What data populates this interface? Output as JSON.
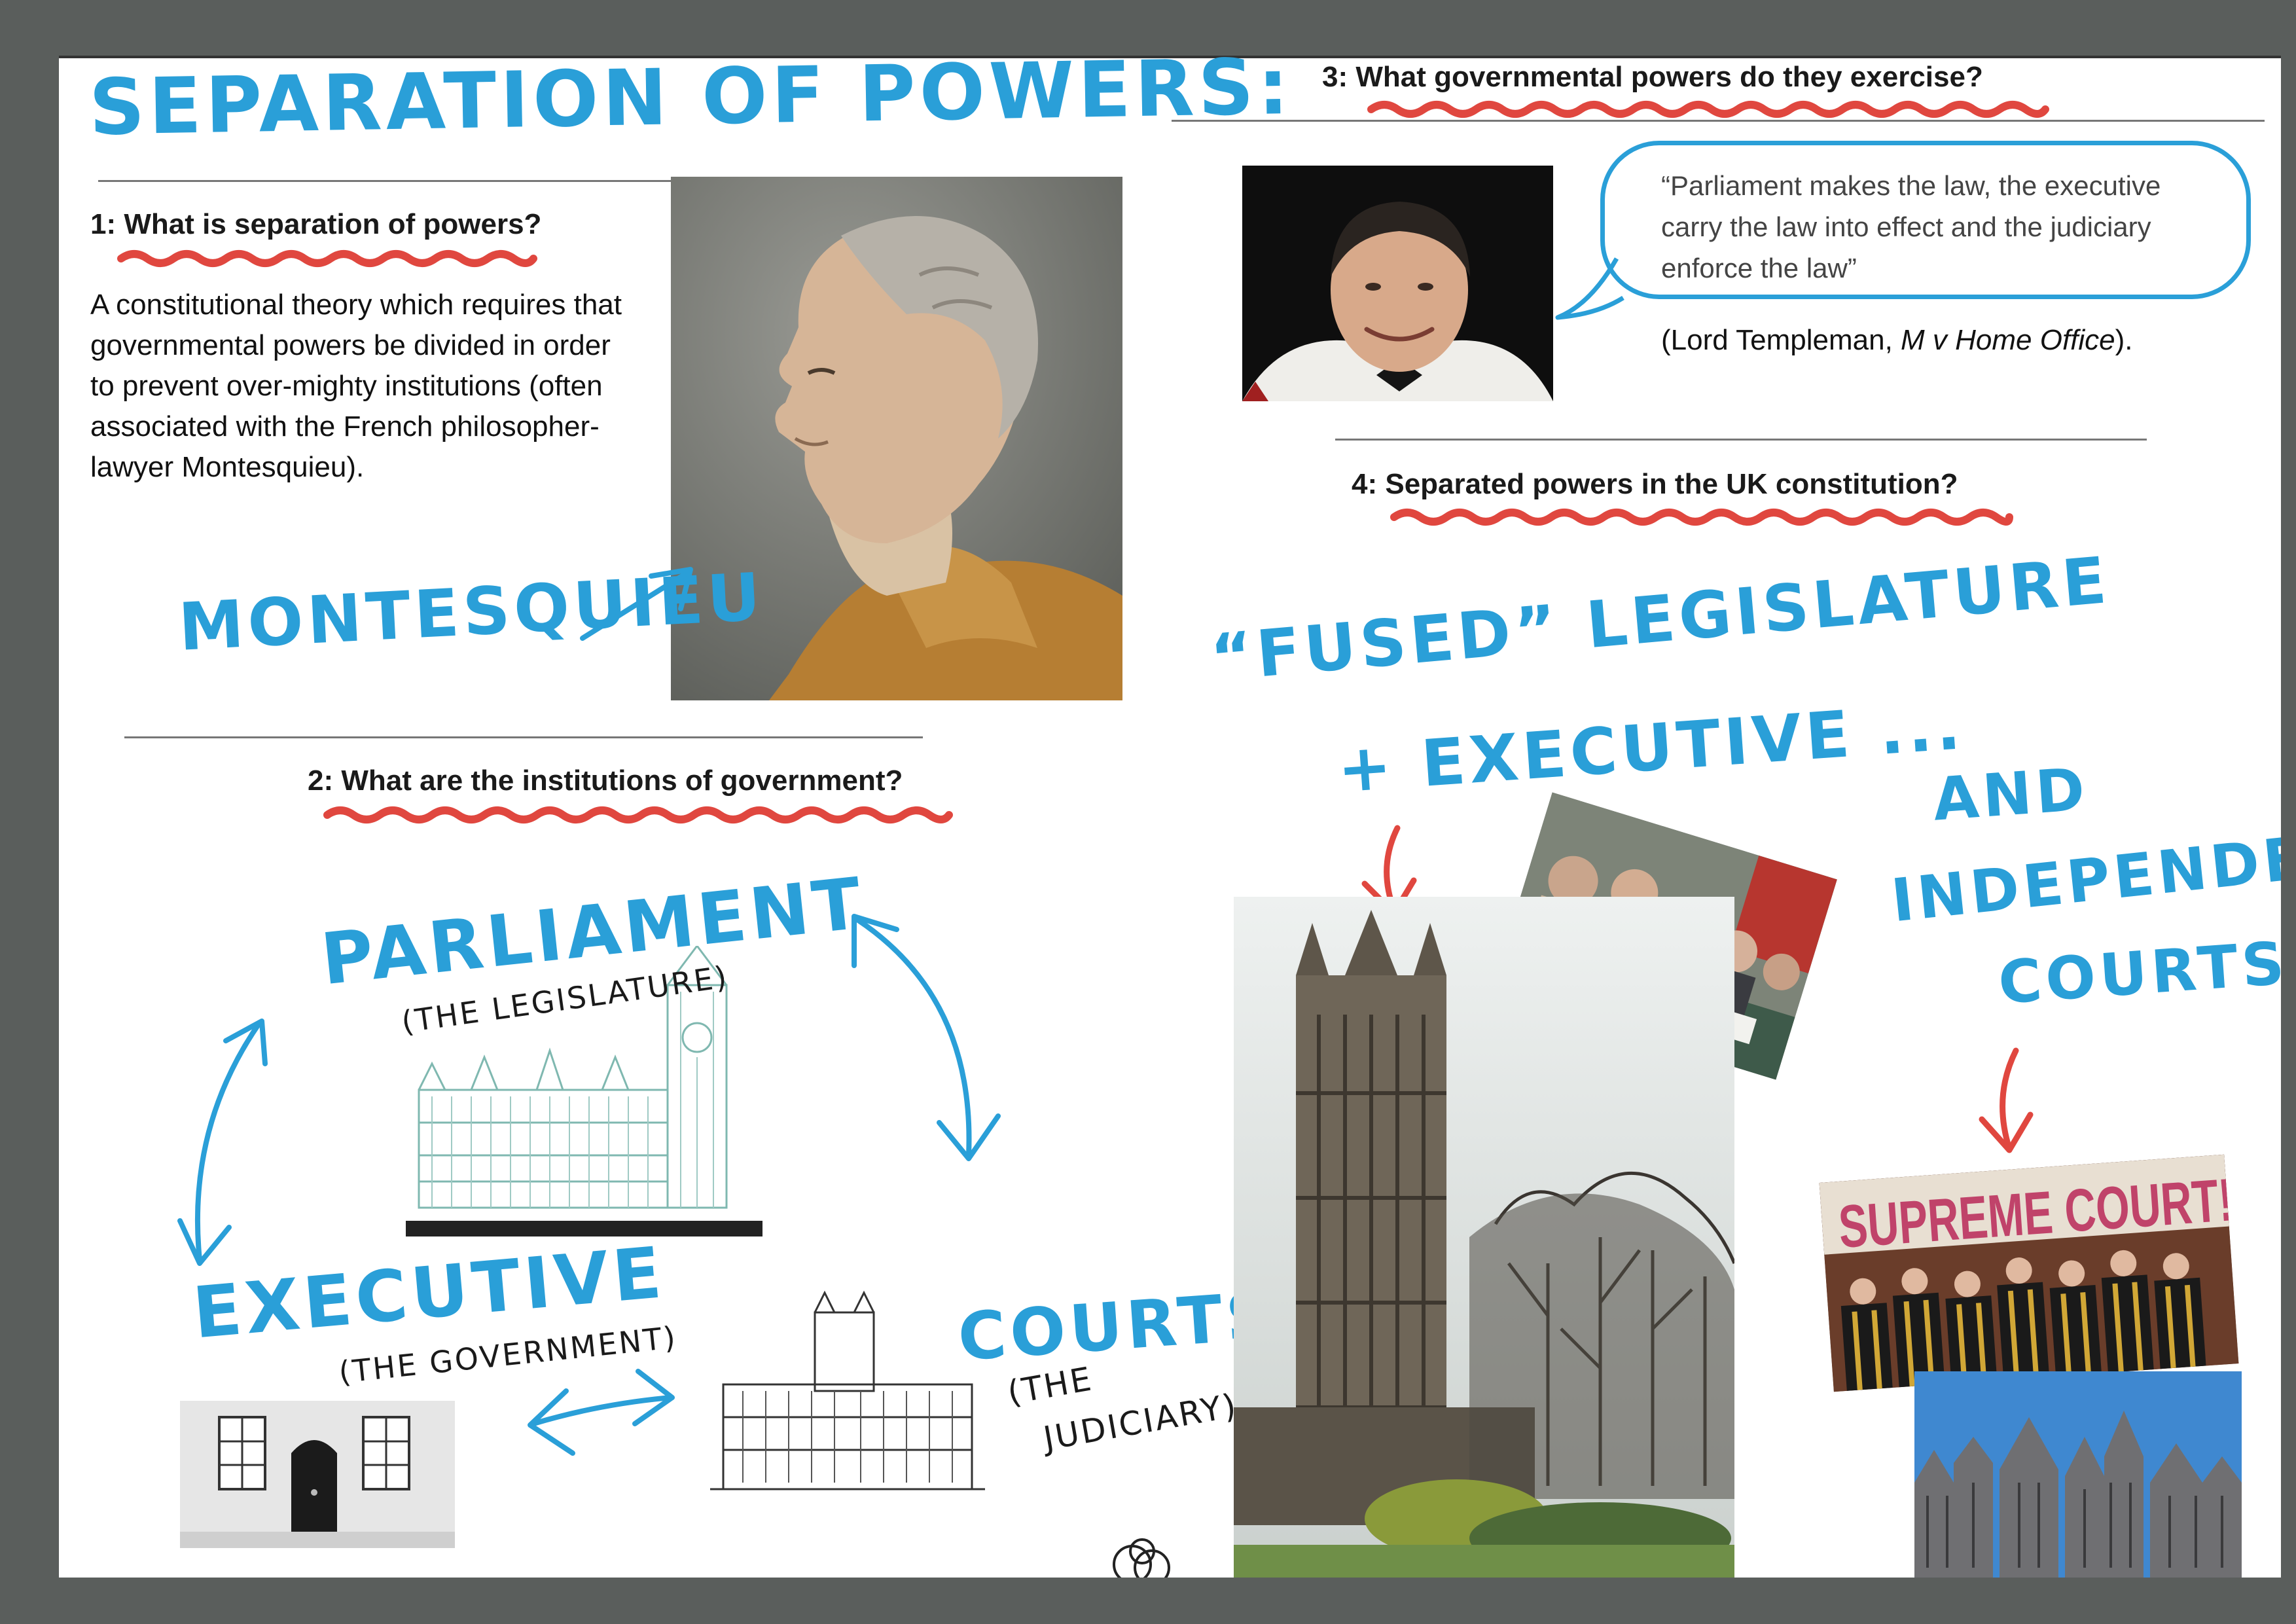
{
  "title": "SEPARATION OF POWERS:",
  "q1": {
    "heading": "1: What is separation of powers?",
    "body": "A constitutional theory which requires that governmental powers be divided in order to prevent over-mighty institutions (often associated with the French philosopher-lawyer Montesquieu)."
  },
  "montesquieu_label": "MONTESQUIEU",
  "q2": {
    "heading": "2: What are the institutions of government?",
    "parliament": "PARLIAMENT",
    "parliament_sub": "(THE LEGISLATURE)",
    "executive": "EXECUTIVE",
    "executive_sub": "(THE GOVERNMENT)",
    "courts": "COURTS",
    "courts_sub_1": "(THE",
    "courts_sub_2": "JUDICIARY)",
    "stock_watermark": "alamy"
  },
  "q3": {
    "heading": "3: What governmental powers do they exercise?",
    "quote": "“Parliament makes the law, the executive carry the law into effect and the judiciary enforce the law”",
    "citation_prefix": "(Lord Templeman, ",
    "citation_case": "M v Home Office",
    "citation_suffix": ")."
  },
  "q4": {
    "heading": "4: Separated powers in the UK constitution?",
    "fused_1": "“FUSED” LEGISLATURE",
    "fused_2": "+ EXECUTIVE ...",
    "courts_1": "AND",
    "courts_2": "INDEPENDENT",
    "courts_3": "COURTS",
    "supreme_sign": "SUPREME COURT!"
  },
  "colors": {
    "ink_blue": "#2a9fd8",
    "underline_red": "#e0473f"
  }
}
